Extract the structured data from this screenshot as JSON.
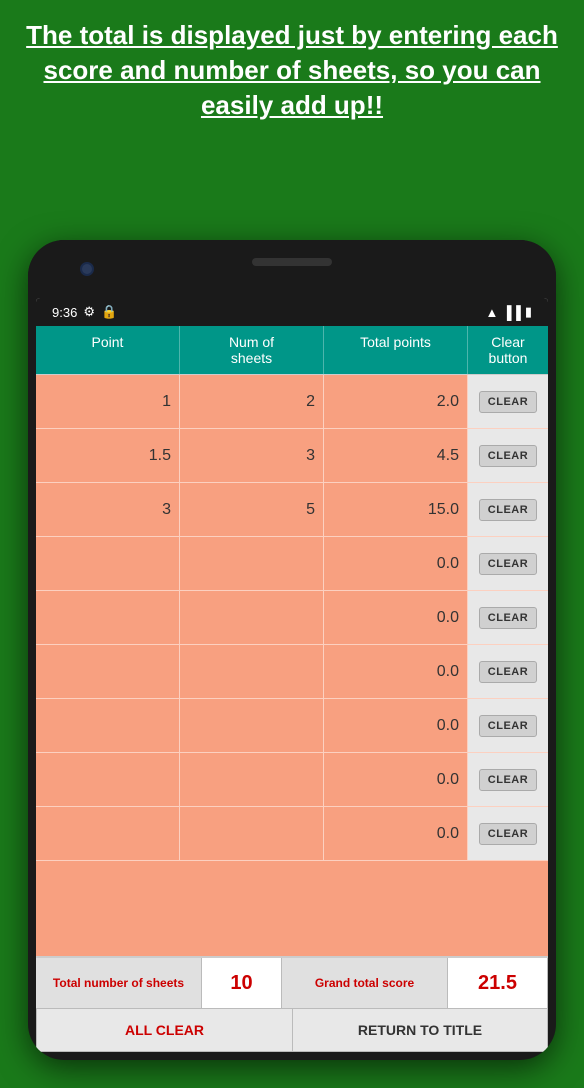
{
  "page": {
    "background_color": "#1a7a1a",
    "header_text": "The total is displayed just by entering each score and number of sheets, so you can easily add up!!"
  },
  "status_bar": {
    "time": "9:36",
    "icons": [
      "settings-icon",
      "lock-icon",
      "wifi-icon",
      "signal-icon",
      "battery-icon"
    ]
  },
  "table": {
    "headers": [
      "Point",
      "Num of sheets",
      "Total points",
      "Clear button"
    ],
    "rows": [
      {
        "point": "1",
        "num_sheets": "2",
        "total_points": "2.0"
      },
      {
        "point": "1.5",
        "num_sheets": "3",
        "total_points": "4.5"
      },
      {
        "point": "3",
        "num_sheets": "5",
        "total_points": "15.0"
      },
      {
        "point": "",
        "num_sheets": "",
        "total_points": "0.0"
      },
      {
        "point": "",
        "num_sheets": "",
        "total_points": "0.0"
      },
      {
        "point": "",
        "num_sheets": "",
        "total_points": "0.0"
      },
      {
        "point": "",
        "num_sheets": "",
        "total_points": "0.0"
      },
      {
        "point": "",
        "num_sheets": "",
        "total_points": "0.0"
      },
      {
        "point": "",
        "num_sheets": "",
        "total_points": "0.0"
      }
    ],
    "clear_btn_label": "CLEAR"
  },
  "footer": {
    "total_sheets_label": "Total number of sheets",
    "total_sheets_value": "10",
    "grand_total_label": "Grand total score",
    "grand_total_value": "21.5"
  },
  "bottom_buttons": {
    "all_clear": "ALL CLEAR",
    "return_title": "RETURN TO TITLE"
  }
}
